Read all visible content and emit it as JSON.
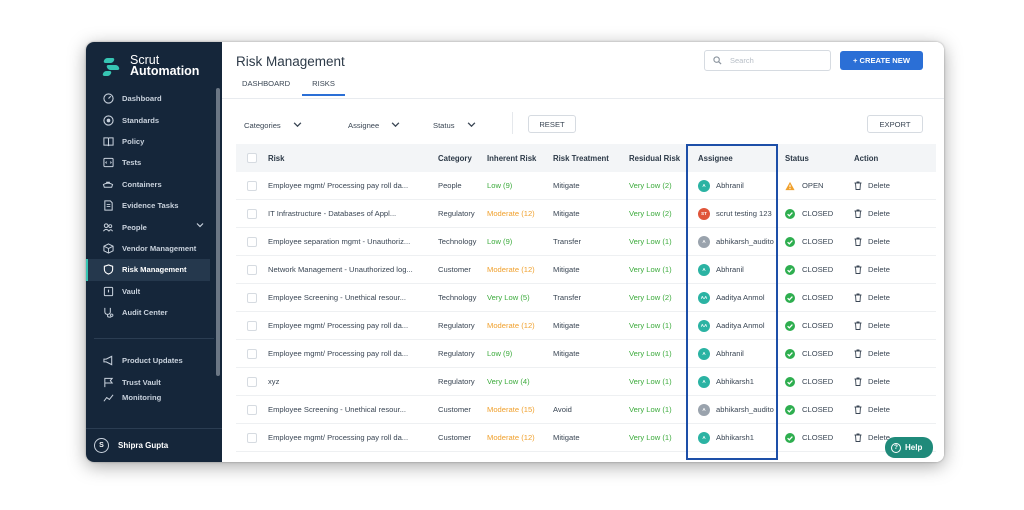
{
  "app": {
    "logo_line1": "Scrut",
    "logo_line2": "Automation",
    "brand_color": "#37c5b3",
    "sidebar_bg": "#15263a",
    "accent": "#2b6fd6"
  },
  "sidebar": {
    "items": [
      {
        "label": "Dashboard",
        "icon": "dashboard-icon"
      },
      {
        "label": "Standards",
        "icon": "standards-icon"
      },
      {
        "label": "Policy",
        "icon": "policy-icon"
      },
      {
        "label": "Tests",
        "icon": "tests-icon"
      },
      {
        "label": "Containers",
        "icon": "containers-icon"
      },
      {
        "label": "Evidence Tasks",
        "icon": "evidence-icon"
      },
      {
        "label": "People",
        "icon": "people-icon"
      },
      {
        "label": "Vendor Management",
        "icon": "vendor-icon"
      },
      {
        "label": "Risk Management",
        "icon": "shield-icon",
        "active": true
      },
      {
        "label": "Vault",
        "icon": "vault-icon"
      },
      {
        "label": "Audit Center",
        "icon": "audit-icon"
      }
    ],
    "secondary": [
      {
        "label": "Product Updates",
        "icon": "megaphone-icon"
      },
      {
        "label": "Trust Vault",
        "icon": "flag-icon"
      },
      {
        "label": "Monitoring",
        "icon": "monitoring-icon"
      }
    ],
    "user_initial": "S",
    "user_name": "Shipra Gupta"
  },
  "header": {
    "title": "Risk Management",
    "tabs": [
      "DASHBOARD",
      "RISKS"
    ],
    "active_tab": "RISKS",
    "search_placeholder": "Search",
    "create_label": "+ CREATE NEW"
  },
  "filters": {
    "categories": "Categories",
    "assignee": "Assignee",
    "status": "Status",
    "reset": "RESET",
    "export": "EXPORT"
  },
  "table": {
    "headers": [
      "Risk",
      "Category",
      "Inherent Risk",
      "Risk Treatment",
      "Residual Risk",
      "Assignee",
      "Status",
      "Action"
    ],
    "rows": [
      {
        "risk": "Employee mgmt/ Processing pay roll da...",
        "category": "People",
        "inherent": "Low (9)",
        "inh_level": "low",
        "treatment": "Mitigate",
        "residual": "Very Low (2)",
        "assignee": "Abhranil",
        "av": "A",
        "av_color": "#2bb3a3",
        "status": "OPEN",
        "open": true,
        "action": "Delete"
      },
      {
        "risk": "IT Infrastructure - Databases of Appl...",
        "category": "Regulatory",
        "inherent": "Moderate (12)",
        "inh_level": "mod",
        "treatment": "Mitigate",
        "residual": "Very Low (2)",
        "assignee": "scrut testing 123",
        "av": "ST",
        "av_color": "#e0553a",
        "status": "CLOSED",
        "open": false,
        "action": "Delete"
      },
      {
        "risk": "Employee separation mgmt - Unauthoriz...",
        "category": "Technology",
        "inherent": "Low (9)",
        "inh_level": "low",
        "treatment": "Transfer",
        "residual": "Very Low (1)",
        "assignee": "abhikarsh_audito",
        "av": "A",
        "av_color": "#9aa3ad",
        "status": "CLOSED",
        "open": false,
        "action": "Delete"
      },
      {
        "risk": "Network Management - Unauthorized log...",
        "category": "Customer",
        "inherent": "Moderate (12)",
        "inh_level": "mod",
        "treatment": "Mitigate",
        "residual": "Very Low (1)",
        "assignee": "Abhranil",
        "av": "A",
        "av_color": "#2bb3a3",
        "status": "CLOSED",
        "open": false,
        "action": "Delete"
      },
      {
        "risk": "Employee Screening - Unethical resour...",
        "category": "Technology",
        "inherent": "Very Low (5)",
        "inh_level": "low",
        "treatment": "Transfer",
        "residual": "Very Low (2)",
        "assignee": "Aaditya Anmol",
        "av": "AA",
        "av_color": "#2bb3a3",
        "status": "CLOSED",
        "open": false,
        "action": "Delete"
      },
      {
        "risk": "Employee mgmt/ Processing pay roll da...",
        "category": "Regulatory",
        "inherent": "Moderate (12)",
        "inh_level": "mod",
        "treatment": "Mitigate",
        "residual": "Very Low (1)",
        "assignee": "Aaditya Anmol",
        "av": "AA",
        "av_color": "#2bb3a3",
        "status": "CLOSED",
        "open": false,
        "action": "Delete"
      },
      {
        "risk": "Employee mgmt/ Processing pay roll da...",
        "category": "Regulatory",
        "inherent": "Low (9)",
        "inh_level": "low",
        "treatment": "Mitigate",
        "residual": "Very Low (1)",
        "assignee": "Abhranil",
        "av": "A",
        "av_color": "#2bb3a3",
        "status": "CLOSED",
        "open": false,
        "action": "Delete"
      },
      {
        "risk": "xyz",
        "category": "Regulatory",
        "inherent": "Very Low (4)",
        "inh_level": "low",
        "treatment": "",
        "residual": "Very Low (1)",
        "assignee": "Abhikarsh1",
        "av": "A",
        "av_color": "#2bb3a3",
        "status": "CLOSED",
        "open": false,
        "action": "Delete"
      },
      {
        "risk": "Employee Screening - Unethical resour...",
        "category": "Customer",
        "inherent": "Moderate (15)",
        "inh_level": "mod",
        "treatment": "Avoid",
        "residual": "Very Low (1)",
        "assignee": "abhikarsh_audito",
        "av": "A",
        "av_color": "#9aa3ad",
        "status": "CLOSED",
        "open": false,
        "action": "Delete"
      },
      {
        "risk": "Employee mgmt/ Processing pay roll da...",
        "category": "Customer",
        "inherent": "Moderate (12)",
        "inh_level": "mod",
        "treatment": "Mitigate",
        "residual": "Very Low (1)",
        "assignee": "Abhikarsh1",
        "av": "A",
        "av_color": "#2bb3a3",
        "status": "CLOSED",
        "open": false,
        "action": "Delete"
      }
    ]
  },
  "help_label": "Help"
}
